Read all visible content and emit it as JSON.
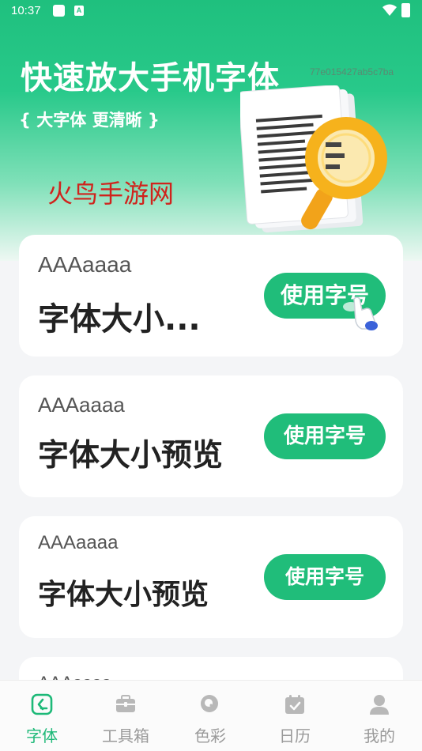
{
  "status_bar": {
    "time": "10:37",
    "notification_badge": "A"
  },
  "header": {
    "title": "快速放大手机字体",
    "subtitle": "{ 大字体 更清晰 }",
    "hash_text": "77e015427ab5c7ba",
    "watermark": "火鸟手游网"
  },
  "cards": [
    {
      "sample": "AAAaaaa",
      "preview": "字体大小...",
      "button": "使用字号"
    },
    {
      "sample": "AAAaaaa",
      "preview": "字体大小预览",
      "button": "使用字号"
    },
    {
      "sample": "AAAaaaa",
      "preview": "字体大小预览",
      "button": "使用字号"
    },
    {
      "sample": "AAAaaaa"
    }
  ],
  "tabs": [
    {
      "label": "字体",
      "icon": "font-icon",
      "active": true
    },
    {
      "label": "工具箱",
      "icon": "toolbox-icon",
      "active": false
    },
    {
      "label": "色彩",
      "icon": "color-search-icon",
      "active": false
    },
    {
      "label": "日历",
      "icon": "calendar-icon",
      "active": false
    },
    {
      "label": "我的",
      "icon": "profile-icon",
      "active": false
    }
  ],
  "colors": {
    "accent": "#20bd7a",
    "tab_inactive": "#9a9a9a",
    "watermark": "#d0231c"
  }
}
